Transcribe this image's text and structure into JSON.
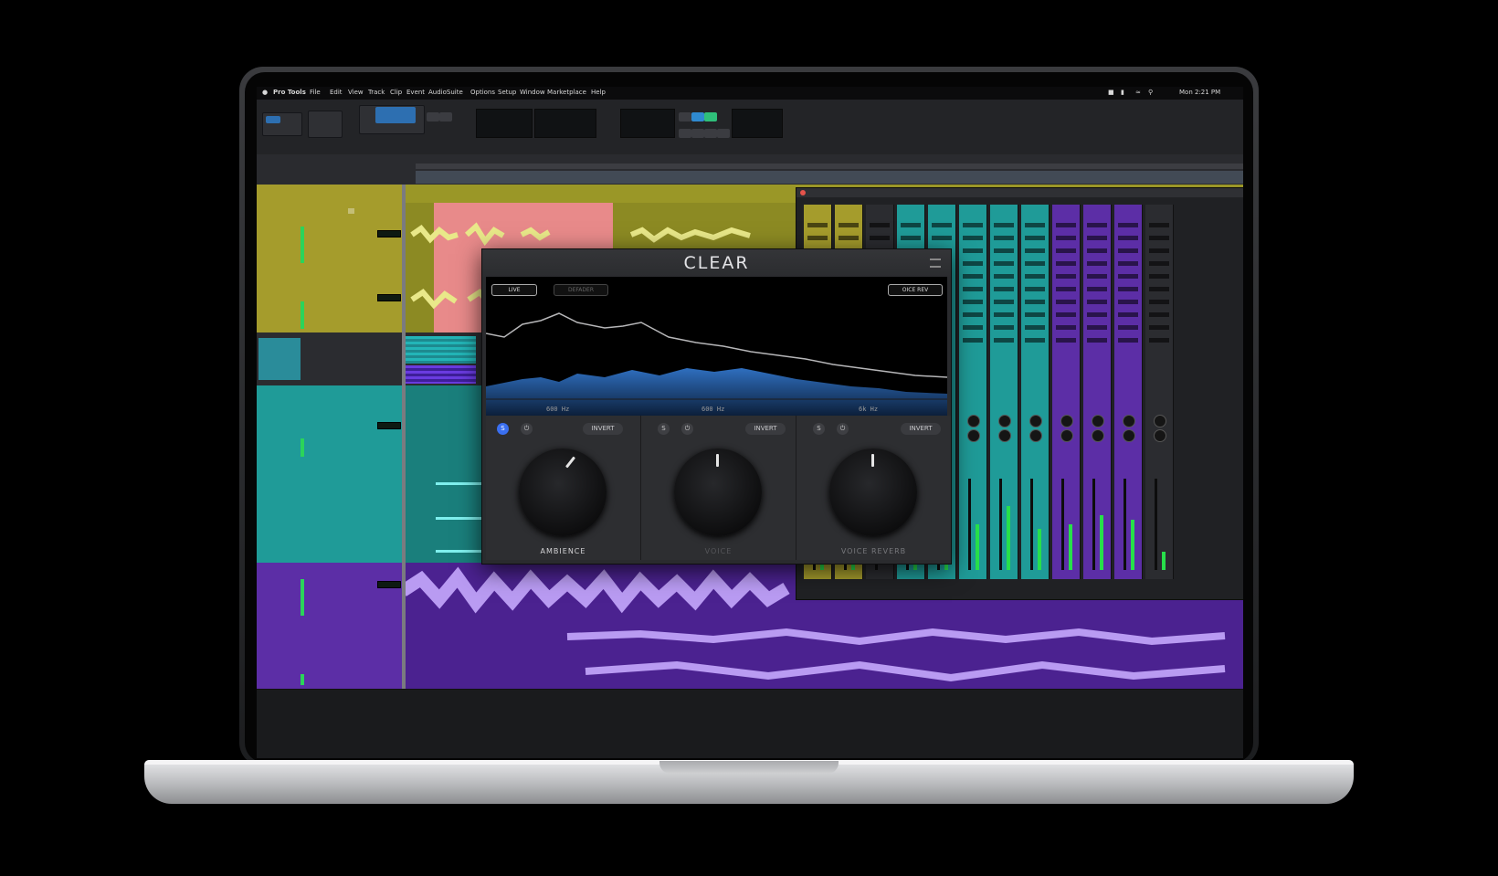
{
  "menubar": {
    "app_name": "Pro Tools",
    "items": [
      "File",
      "Edit",
      "View",
      "Track",
      "Clip",
      "Event",
      "AudioSuite",
      "Options",
      "Setup",
      "Window",
      "Marketplace",
      "Help"
    ],
    "clock": "Mon 2:21 PM"
  },
  "plugin": {
    "title": "CLEAR",
    "toggle_live": "LIVE",
    "toggle_defader": "DEFADER",
    "preset": "OICE REV",
    "scale_labels": [
      "600 Hz",
      "600 Hz",
      "6k Hz"
    ],
    "invert_label": "INVERT",
    "knobs": [
      {
        "label": "AMBIENCE"
      },
      {
        "label": "VOICE"
      },
      {
        "label": "VOICE REVERB"
      }
    ],
    "solo_label": "S"
  },
  "colors": {
    "yellow_track": "#a59c2c",
    "yellow_lane": "#8c8a23",
    "clip_pink": "#e88a8a",
    "teal_track": "#1f9b98",
    "purple_track": "#5c2ea6",
    "purple_wave": "#b99bf2",
    "meter_green": "#2bd45a",
    "select_blue": "#2d6fb1"
  },
  "icons": [
    "apple-icon",
    "wifi-icon",
    "battery-icon",
    "search-icon",
    "control-center-icon",
    "play-icon",
    "stop-icon",
    "record-icon",
    "power-icon",
    "menu-icon"
  ]
}
